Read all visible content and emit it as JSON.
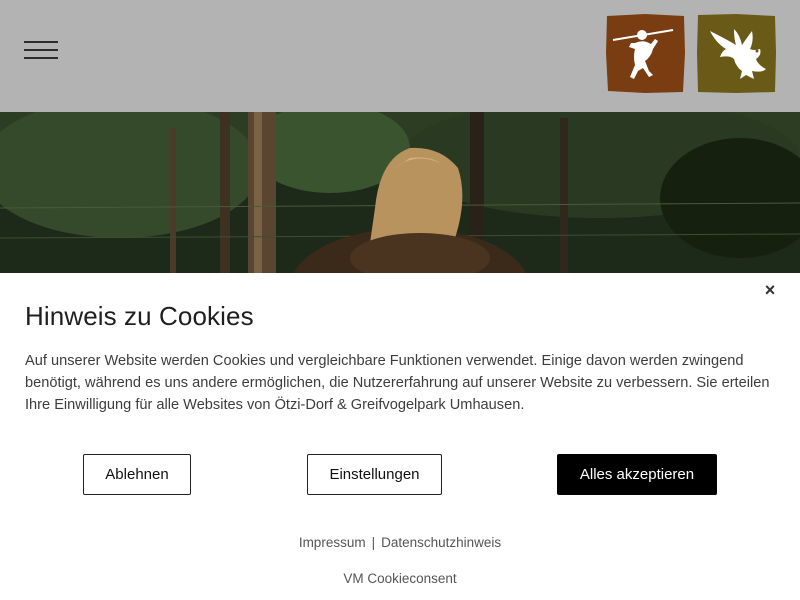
{
  "header": {
    "menu_icon": "hamburger-menu-icon",
    "logos": [
      {
        "name": "oetzi-dorf-logo",
        "icon": "stone-age-hunter-icon",
        "color": "#7a3d12"
      },
      {
        "name": "greifvogelpark-logo",
        "icon": "eagle-icon",
        "color": "#6a5a17"
      }
    ]
  },
  "cookie_banner": {
    "title": "Hinweis zu Cookies",
    "text": "Auf unserer Website werden Cookies und vergleichbare Funktionen verwendet. Einige davon werden zwingend benötigt, während es uns andere ermöglichen, die Nutzererfahrung auf unserer Website zu verbessern. Sie erteilen Ihre Einwilligung für alle Websites von Ötzi-Dorf & Greifvogelpark Umhausen.",
    "close_label": "×",
    "buttons": {
      "decline": "Ablehnen",
      "settings": "Einstellungen",
      "accept": "Alles akzeptieren"
    },
    "links": {
      "imprint": "Impressum",
      "separator": "|",
      "privacy": "Datenschutzhinweis"
    },
    "powered_by": "VM Cookieconsent"
  },
  "colors": {
    "header_bg": "#b3b3b3",
    "accept_bg": "#000000",
    "logo_oetzi": "#7a3d12",
    "logo_bird": "#6a5a17"
  }
}
